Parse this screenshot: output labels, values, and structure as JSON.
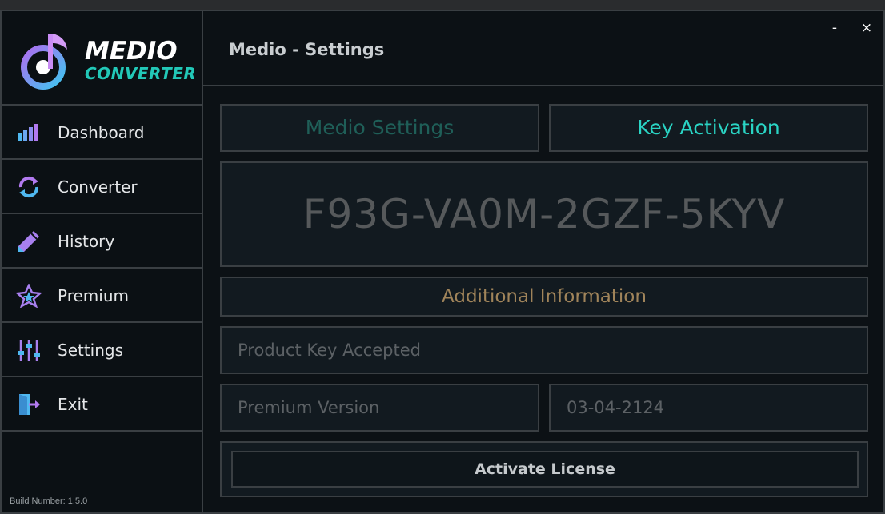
{
  "app": {
    "logo_line1": "MEDIO",
    "logo_line2": "CONVERTER",
    "build_number": "Build Number: 1.5.0",
    "accent_color": "#22c8b8"
  },
  "window": {
    "title": "Medio - Settings",
    "minimize_label": "-",
    "close_label": "×"
  },
  "sidebar": {
    "items": [
      {
        "label": "Dashboard",
        "icon": "bar-chart-icon"
      },
      {
        "label": "Converter",
        "icon": "convert-arrows-icon"
      },
      {
        "label": "History",
        "icon": "pencil-icon"
      },
      {
        "label": "Premium",
        "icon": "star-icon"
      },
      {
        "label": "Settings",
        "icon": "sliders-icon"
      },
      {
        "label": "Exit",
        "icon": "exit-door-icon"
      }
    ]
  },
  "tabs": {
    "settings_label": "Medio Settings",
    "key_label": "Key Activation"
  },
  "key": {
    "value": "F93G-VA0M-2GZF-5KYV"
  },
  "info": {
    "header": "Additional Information",
    "status": "Product Key Accepted",
    "version": "Premium Version",
    "date": "03-04-2124"
  },
  "actions": {
    "activate_label": "Activate License"
  }
}
